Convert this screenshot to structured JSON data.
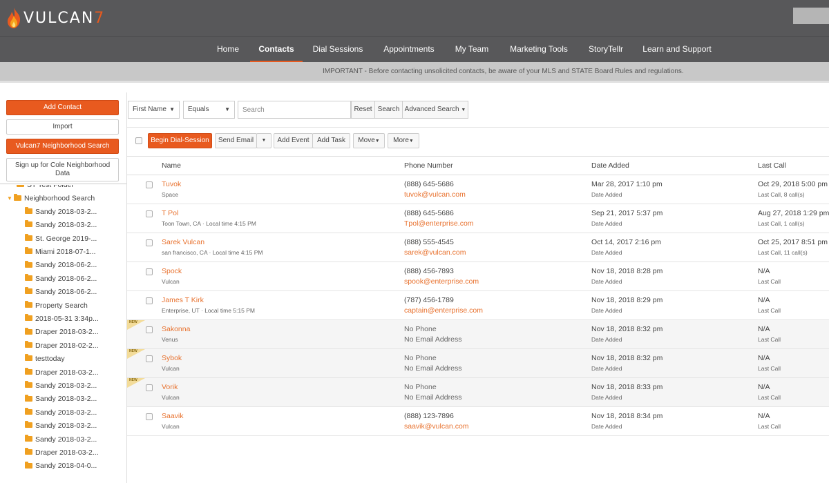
{
  "header": {
    "logo_text": "VULCAN",
    "logo_number": "7"
  },
  "nav": [
    "Home",
    "Contacts",
    "Dial Sessions",
    "Appointments",
    "My Team",
    "Marketing Tools",
    "StoryTellr",
    "Learn and Support"
  ],
  "nav_active": "Contacts",
  "notice": "IMPORTANT - Before contacting unsolicited contacts, be aware of your MLS and STATE Board Rules and regulations.",
  "sidebar": {
    "add_contact": "Add Contact",
    "import": "Import",
    "neighborhood_search": "Vulcan7 Neighborhood Search",
    "signup_line1": "Sign up for Cole Neighborhood",
    "signup_line2": "Data",
    "tree": [
      "ST Test Folder",
      "Neighborhood Search",
      "Sandy 2018-03-2...",
      "Sandy 2018-03-2...",
      "St. George 2019-...",
      "Miami 2018-07-1...",
      "Sandy 2018-06-2...",
      "Sandy 2018-06-2...",
      "Sandy 2018-06-2...",
      "Property Search",
      "2018-05-31 3:34p...",
      "Draper 2018-03-2...",
      "Draper 2018-02-2...",
      "testtoday",
      "Draper 2018-03-2...",
      "Sandy 2018-03-2...",
      "Sandy 2018-03-2...",
      "Sandy 2018-03-2...",
      "Sandy 2018-03-2...",
      "Sandy 2018-03-2...",
      "Draper 2018-03-2...",
      "Sandy 2018-04-0..."
    ]
  },
  "filters": {
    "field": "First Name",
    "operator": "Equals",
    "search_placeholder": "Search",
    "reset": "Reset",
    "search": "Search",
    "advanced": "Advanced Search"
  },
  "actions": {
    "begin": "Begin Dial-Session",
    "send_email": "Send Email",
    "add_event": "Add Event",
    "add_task": "Add Task",
    "move": "Move",
    "more": "More"
  },
  "columns": [
    "Name",
    "Phone Number",
    "Date Added",
    "Last Call"
  ],
  "badges": {
    "new": "NEW"
  },
  "contacts": [
    {
      "name": "Tuvok",
      "sub": "Space",
      "phone": "(888) 645-5686",
      "email": "tuvok@vulcan.com",
      "date": "Mar 28, 2017 1:10 pm",
      "date_label": "Date Added",
      "last_call": "Oct 29, 2018 5:00 pm",
      "last_call_sub": "Last Call, 8 call(s)"
    },
    {
      "name": "T Pol",
      "sub": "Toon Town, CA · Local time 4:15 PM",
      "phone": "(888) 645-5686",
      "email": "Tpol@enterprise.com",
      "date": "Sep 21, 2017 5:37 pm",
      "date_label": "Date Added",
      "last_call": "Aug 27, 2018 1:29 pm",
      "last_call_sub": "Last Call, 1 call(s)"
    },
    {
      "name": "Sarek Vulcan",
      "sub": "san francisco, CA · Local time 4:15 PM",
      "phone": "(888) 555-4545",
      "email": "sarek@vulcan.com",
      "date": "Oct 14, 2017 2:16 pm",
      "date_label": "Date Added",
      "last_call": "Oct 25, 2017 8:51 pm",
      "last_call_sub": "Last Call, 11 call(s)"
    },
    {
      "name": "Spock",
      "sub": "Vulcan",
      "phone": "(888) 456-7893",
      "email": "spook@enterprise.com",
      "date": "Nov 18, 2018 8:28 pm",
      "date_label": "Date Added",
      "last_call": "N/A",
      "last_call_sub": "Last Call"
    },
    {
      "name": "James T Kirk",
      "sub": "Enterprise, UT · Local time 5:15 PM",
      "phone": "(787) 456-1789",
      "email": "captain@enterprise.com",
      "date": "Nov 18, 2018 8:29 pm",
      "date_label": "Date Added",
      "last_call": "N/A",
      "last_call_sub": "Last Call"
    },
    {
      "name": "Sakonna",
      "sub": "Venus",
      "phone": "No Phone",
      "email": "No Email Address",
      "date": "Nov 18, 2018 8:32 pm",
      "date_label": "Date Added",
      "last_call": "N/A",
      "last_call_sub": "Last Call",
      "is_new": true
    },
    {
      "name": "Sybok",
      "sub": "Vulcan",
      "phone": "No Phone",
      "email": "No Email Address",
      "date": "Nov 18, 2018 8:32 pm",
      "date_label": "Date Added",
      "last_call": "N/A",
      "last_call_sub": "Last Call",
      "is_new": true
    },
    {
      "name": "Vorik",
      "sub": "Vulcan",
      "phone": "No Phone",
      "email": "No Email Address",
      "date": "Nov 18, 2018 8:33 pm",
      "date_label": "Date Added",
      "last_call": "N/A",
      "last_call_sub": "Last Call",
      "is_new": true
    },
    {
      "name": "Saavik",
      "sub": "Vulcan",
      "phone": "(888) 123-7896",
      "email": "saavik@vulcan.com",
      "date": "Nov 18, 2018 8:34 pm",
      "date_label": "Date Added",
      "last_call": "N/A",
      "last_call_sub": "Last Call"
    }
  ],
  "colors": {
    "accent": "#e85a1f",
    "link": "#e8722f",
    "header": "#58585a",
    "folder": "#f0a020"
  }
}
